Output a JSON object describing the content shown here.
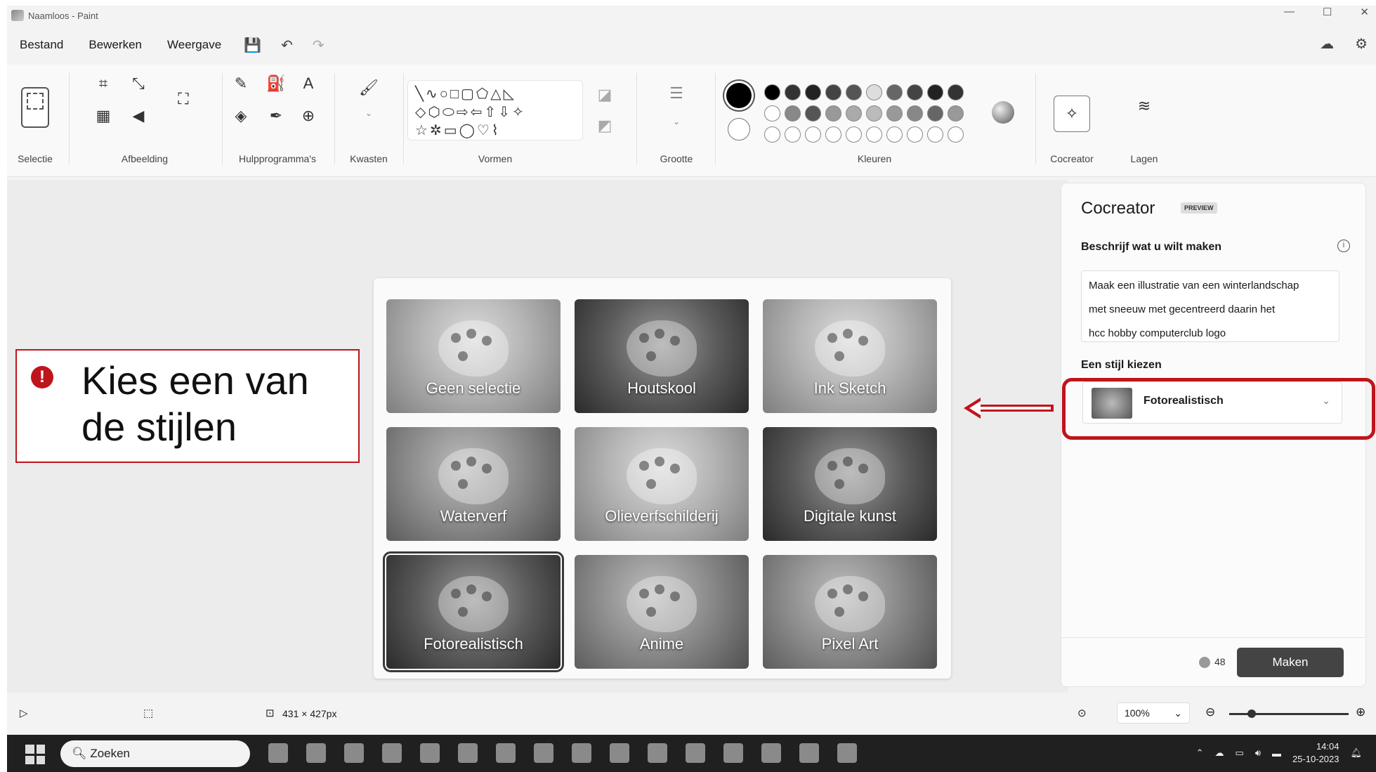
{
  "window": {
    "title": "Naamloos - Paint",
    "controls": [
      "—",
      "☐",
      "✕"
    ]
  },
  "menu": {
    "file": "Bestand",
    "edit": "Bewerken",
    "view": "Weergave"
  },
  "ribbon": {
    "selection": "Selectie",
    "image": "Afbeelding",
    "tools": "Hulpprogramma's",
    "brushes": "Kwasten",
    "shapes": "Vormen",
    "size": "Grootte",
    "colors": "Kleuren",
    "cocreator": "Cocreator",
    "layers": "Lagen",
    "shape_rows": [
      "╲∿○□▢⬠△◺",
      "◇⬡⬭⇨⇦⇧⇩✧",
      "☆✲▭◯♡⌇"
    ],
    "text_tool": "A"
  },
  "callout": {
    "icon": "!",
    "text": "Kies een van de stijlen"
  },
  "styles": [
    {
      "label": "Geen selectie",
      "tone": "light"
    },
    {
      "label": "Houtskool",
      "tone": "dark"
    },
    {
      "label": "Ink Sketch",
      "tone": "light"
    },
    {
      "label": "Waterverf",
      "tone": ""
    },
    {
      "label": "Olieverfschilderij",
      "tone": "light"
    },
    {
      "label": "Digitale kunst",
      "tone": "dark"
    },
    {
      "label": "Fotorealistisch",
      "tone": "dark"
    },
    {
      "label": "Anime",
      "tone": ""
    },
    {
      "label": "Pixel Art",
      "tone": ""
    }
  ],
  "cocreator": {
    "title": "Cocreator",
    "badge": "PREVIEW",
    "prompt_label": "Beschrijf wat u wilt maken",
    "info_icon": "i",
    "prompt_lines": [
      "Maak een illustratie van een winterlandschap",
      "met sneeuw met gecentreerd daarin het",
      "hcc hobby computerclub logo"
    ],
    "style_label": "Een stijl kiezen",
    "style_value": "Fotorealistisch",
    "credits": "48",
    "make_button": "Maken"
  },
  "status": {
    "canvas_size": "431 × 427px",
    "zoom": "100%"
  },
  "taskbar": {
    "search_placeholder": "Zoeken",
    "time": "14:04",
    "date": "25-10-2023"
  },
  "colors": {
    "accent_red": "#c0141c",
    "make_button": "#444444"
  }
}
